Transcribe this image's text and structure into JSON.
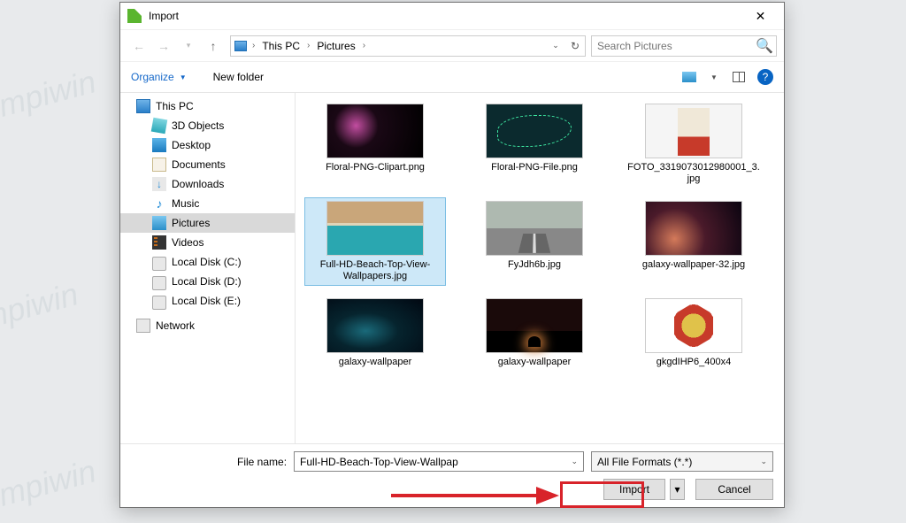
{
  "dialog": {
    "title": "Import"
  },
  "nav": {
    "breadcrumb": {
      "root": "This PC",
      "folder": "Pictures"
    },
    "search_placeholder": "Search Pictures"
  },
  "toolbar": {
    "organize": "Organize",
    "newfolder": "New folder"
  },
  "tree": {
    "root": "This PC",
    "items": [
      "3D Objects",
      "Desktop",
      "Documents",
      "Downloads",
      "Music",
      "Pictures",
      "Videos",
      "Local Disk (C:)",
      "Local Disk (D:)",
      "Local Disk (E:)"
    ],
    "network": "Network"
  },
  "files": [
    {
      "name": "Floral-PNG-Clipart.png",
      "cls": "floral1"
    },
    {
      "name": "Floral-PNG-File.png",
      "cls": "floral2"
    },
    {
      "name": "FOTO_3319073012980001_3.jpg",
      "cls": "foto"
    },
    {
      "name": "Full-HD-Beach-Top-View-Wallpapers.jpg",
      "cls": "beach",
      "selected": true
    },
    {
      "name": "FyJdh6b.jpg",
      "cls": "road"
    },
    {
      "name": "galaxy-wallpaper-32.jpg",
      "cls": "galaxy32"
    },
    {
      "name": "galaxy-wallpaper",
      "cls": "gal1"
    },
    {
      "name": "galaxy-wallpaper",
      "cls": "gal2"
    },
    {
      "name": "gkgdIHP6_400x4",
      "cls": "badge"
    }
  ],
  "footer": {
    "filename_label": "File name:",
    "filename_value": "Full-HD-Beach-Top-View-Wallpap",
    "filter": "All File Formats (*.*)",
    "import": "Import",
    "cancel": "Cancel"
  }
}
